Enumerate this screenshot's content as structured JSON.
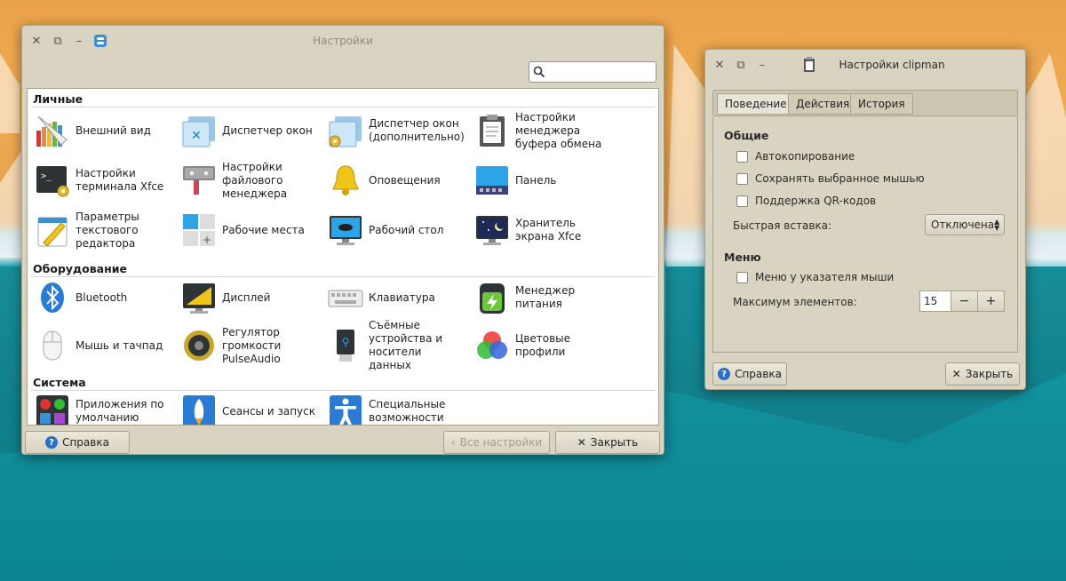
{
  "settings_window": {
    "title": "Настройки",
    "search": {
      "value": "",
      "placeholder": ""
    },
    "sections": {
      "personal": "Личные",
      "hardware": "Оборудование",
      "system": "Система"
    },
    "items": {
      "appearance": "Внешний вид",
      "window_manager": "Диспетчер окон",
      "wm_tweaks": "Диспетчер окон (дополнительно)",
      "clipman": "Настройки менеджера буфера обмена",
      "terminal": "Настройки терминала Xfce",
      "file_manager": "Настройки файлового менеджера",
      "notifications": "Оповещения",
      "panel": "Панель",
      "mousepad": "Параметры текстового редактора",
      "workspaces": "Рабочие места",
      "desktop": "Рабочий стол",
      "screensaver": "Хранитель экрана Xfce",
      "bluetooth": "Bluetooth",
      "display": "Дисплей",
      "keyboard": "Клавиатура",
      "power": "Менеджер питания",
      "mouse": "Мышь и тачпад",
      "pulseaudio": "Регулятор громкости PulseAudio",
      "removable": "Съёмные устройства и носители данных",
      "color": "Цветовые профили",
      "default_apps": "Приложения по умолчанию",
      "sessions": "Сеансы и запуск",
      "accessibility": "Специальные возможности"
    },
    "buttons": {
      "help": "Справка",
      "all_settings": "Все настройки",
      "close": "Закрыть"
    }
  },
  "clipman_window": {
    "title": "Настройки clipman",
    "tabs": [
      "Поведение",
      "Действия",
      "История"
    ],
    "general": {
      "title": "Общие",
      "autocopy": "Автокопирование",
      "save_selection": "Сохранять выбранное мышью",
      "qr": "Поддержка QR-кодов",
      "paste_label": "Быстрая вставка:",
      "paste_value": "Отключена"
    },
    "menu": {
      "title": "Меню",
      "at_pointer": "Меню у указателя мыши",
      "max_label": "Максимум элементов:",
      "max_value": "15",
      "minus": "−",
      "plus": "+"
    },
    "buttons": {
      "help": "Справка",
      "close": "Закрыть"
    }
  }
}
